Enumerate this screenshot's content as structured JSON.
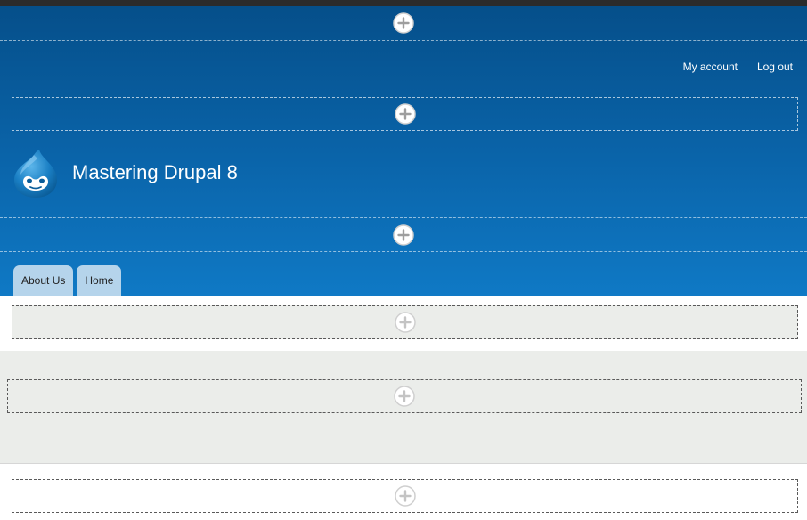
{
  "site": {
    "name": "Mastering Drupal 8",
    "logo_icon": "drupal-drop-icon"
  },
  "secondary_menu": {
    "items": [
      {
        "label": "My account"
      },
      {
        "label": "Log out"
      }
    ]
  },
  "primary_menu": {
    "tabs": [
      {
        "label": "About Us"
      },
      {
        "label": "Home"
      }
    ]
  },
  "colors": {
    "header_top": "#054f8a",
    "header_bottom": "#0f79c5",
    "tab_background": "#b5d4eb",
    "gray_region": "#ebedea"
  },
  "icons": {
    "add_block": "plus-circle-icon"
  }
}
